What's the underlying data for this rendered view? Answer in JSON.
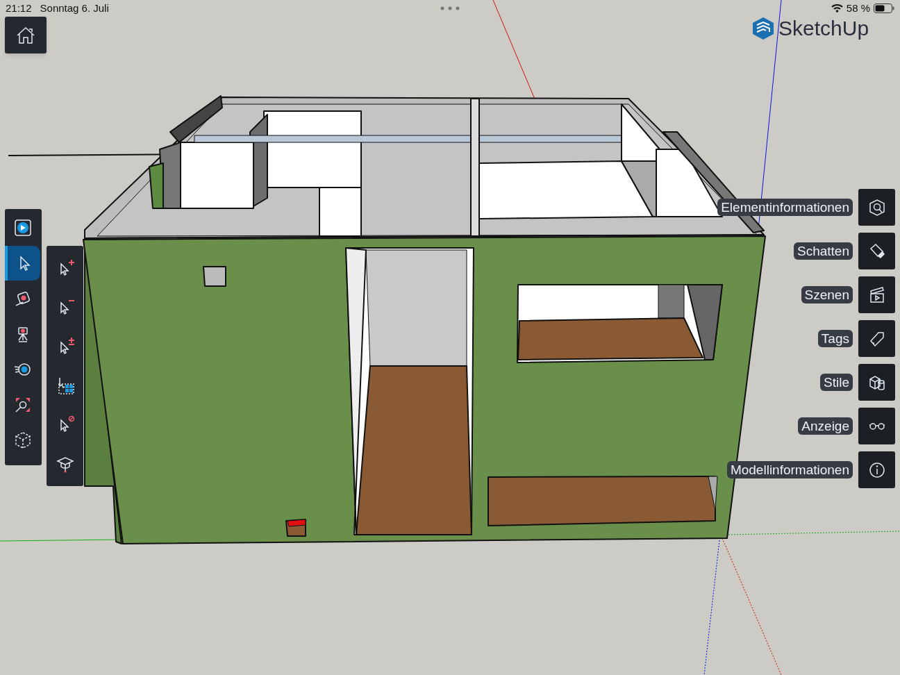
{
  "status_bar": {
    "time": "21:12",
    "date": "Sonntag 6. Juli",
    "battery": "58 %"
  },
  "logo": {
    "text": "SketchUp"
  },
  "tools": [
    {
      "kind": "play",
      "selected": false
    },
    {
      "kind": "select",
      "selected": true
    },
    {
      "kind": "tape",
      "selected": false
    },
    {
      "kind": "camera",
      "selected": false
    },
    {
      "kind": "orbit",
      "selected": false
    },
    {
      "kind": "zoom-extents",
      "selected": false
    },
    {
      "kind": "views",
      "selected": false
    }
  ],
  "selection_tools": [
    {
      "kind": "add"
    },
    {
      "kind": "subtract"
    },
    {
      "kind": "toggle"
    },
    {
      "kind": "select-all"
    },
    {
      "kind": "deselect"
    },
    {
      "kind": "learn"
    }
  ],
  "panels": [
    {
      "label": "Elementinformationen",
      "kind": "entity"
    },
    {
      "label": "Schatten",
      "kind": "shadow"
    },
    {
      "label": "Szenen",
      "kind": "scenes"
    },
    {
      "label": "Tags",
      "kind": "tag"
    },
    {
      "label": "Stile",
      "kind": "styles"
    },
    {
      "label": "Anzeige",
      "kind": "display"
    },
    {
      "label": "Modellinformationen",
      "kind": "info"
    }
  ]
}
